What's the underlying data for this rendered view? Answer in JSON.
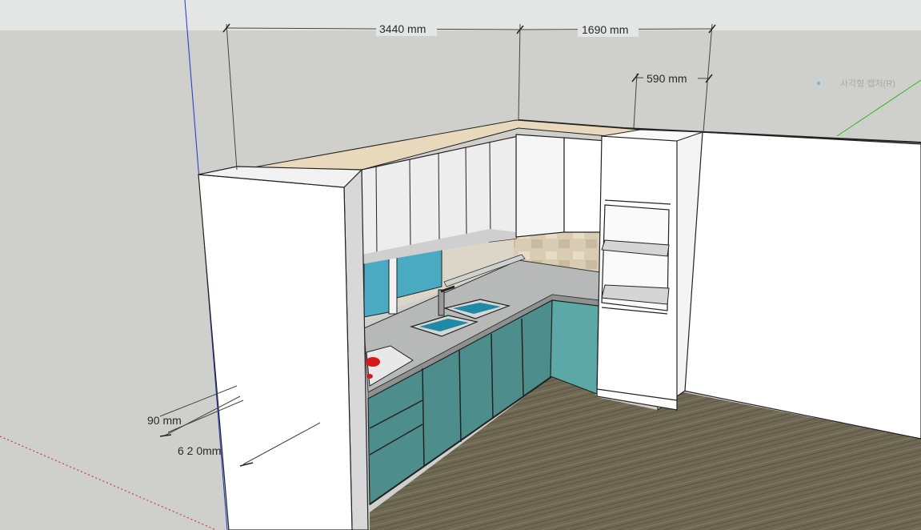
{
  "dimensions": {
    "width_total": "3440 mm",
    "width_right": "1690 mm",
    "tall_unit_depth": "590 mm",
    "panel_thickness": "90 mm",
    "counter_depth": "6 2 0mm"
  },
  "tooltip": {
    "label": "사각형 캡처(R)"
  },
  "colors": {
    "sky": "#e4e6e5",
    "ground": "#cfcfcb",
    "wall": "#ffffff",
    "cabinet_teal": "#4d8e8c",
    "floor_wood": "#6f6853",
    "counter": "#b7b9b9"
  }
}
